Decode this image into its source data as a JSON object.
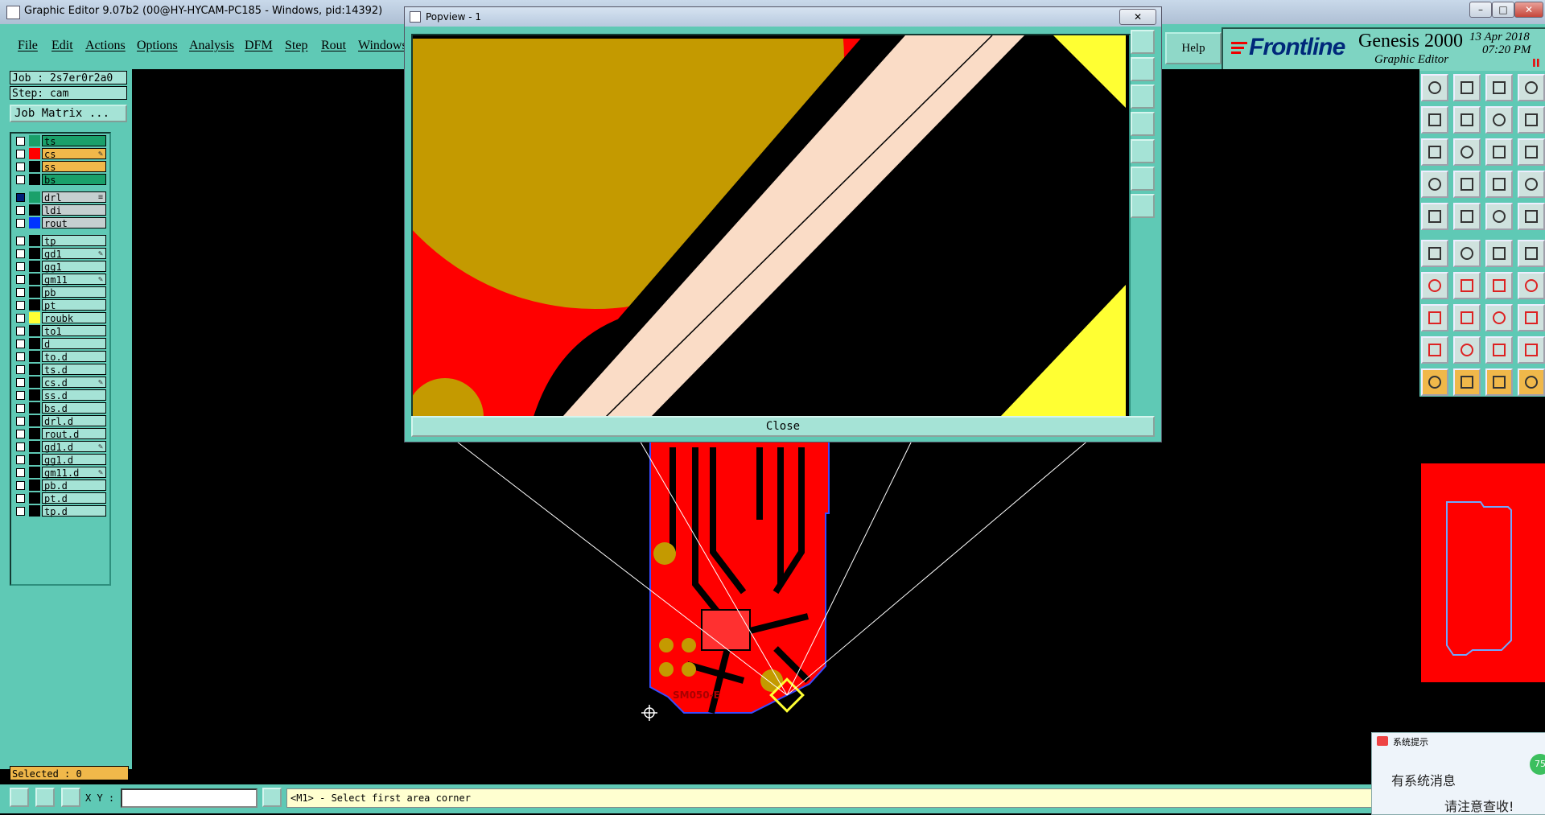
{
  "window": {
    "title": "Graphic Editor 9.07b2 (00@HY-HYCAM-PC185 - Windows, pid:14392)"
  },
  "menu": {
    "items": [
      "File",
      "Edit",
      "Actions",
      "Options",
      "Analysis",
      "DFM",
      "Step",
      "Rout",
      "Windows"
    ],
    "help": "Help"
  },
  "brand": {
    "frontline": "Frontline",
    "product": "Genesis 2000",
    "subtitle": "Graphic Editor",
    "date": "13 Apr 2018",
    "time": "07:20 PM",
    "pause": "II"
  },
  "job": {
    "job": "Job : 2s7er0r2a0",
    "step": "Step: cam",
    "matrix": "Job Matrix ..."
  },
  "layers": [
    {
      "name": "ts",
      "color": "#1aa06a",
      "bg": "#1aa06a"
    },
    {
      "name": "cs",
      "color": "#ff0000",
      "bg": "#f0b84a",
      "mark": "✎"
    },
    {
      "name": "ss",
      "color": "#000000",
      "bg": "#f0b84a"
    },
    {
      "name": "bs",
      "color": "#000000",
      "bg": "#1aa06a"
    },
    {
      "name": "drl",
      "color": "#1aa06a",
      "bg": "#c5cfd0",
      "mark": "≡",
      "check": "#00207a"
    },
    {
      "name": "ldi",
      "color": "#000000",
      "bg": "#c5cfd0"
    },
    {
      "name": "rout",
      "color": "#0033ff",
      "bg": "#c5cfd0"
    },
    {
      "name": "tp",
      "color": "#000000",
      "bg": "#a5e3d6"
    },
    {
      "name": "gd1",
      "color": "#000000",
      "bg": "#a5e3d6",
      "mark": "✎"
    },
    {
      "name": "gg1",
      "color": "#000000",
      "bg": "#a5e3d6"
    },
    {
      "name": "gm11",
      "color": "#000000",
      "bg": "#a5e3d6",
      "mark": "✎"
    },
    {
      "name": "pb",
      "color": "#000000",
      "bg": "#a5e3d6"
    },
    {
      "name": "pt",
      "color": "#000000",
      "bg": "#a5e3d6"
    },
    {
      "name": "roubk",
      "color": "#ffff33",
      "bg": "#a5e3d6"
    },
    {
      "name": "to1",
      "color": "#000000",
      "bg": "#a5e3d6"
    },
    {
      "name": "d",
      "color": "#000000",
      "bg": "#a5e3d6"
    },
    {
      "name": "to.d",
      "color": "#000000",
      "bg": "#a5e3d6"
    },
    {
      "name": "ts.d",
      "color": "#000000",
      "bg": "#a5e3d6"
    },
    {
      "name": "cs.d",
      "color": "#000000",
      "bg": "#a5e3d6",
      "mark": "✎"
    },
    {
      "name": "ss.d",
      "color": "#000000",
      "bg": "#a5e3d6"
    },
    {
      "name": "bs.d",
      "color": "#000000",
      "bg": "#a5e3d6"
    },
    {
      "name": "drl.d",
      "color": "#000000",
      "bg": "#a5e3d6"
    },
    {
      "name": "rout.d",
      "color": "#000000",
      "bg": "#a5e3d6"
    },
    {
      "name": "gd1.d",
      "color": "#000000",
      "bg": "#a5e3d6",
      "mark": "✎"
    },
    {
      "name": "gg1.d",
      "color": "#000000",
      "bg": "#a5e3d6"
    },
    {
      "name": "gm11.d",
      "color": "#000000",
      "bg": "#a5e3d6",
      "mark": "✎"
    },
    {
      "name": "pb.d",
      "color": "#000000",
      "bg": "#a5e3d6"
    },
    {
      "name": "pt.d",
      "color": "#000000",
      "bg": "#a5e3d6"
    },
    {
      "name": "tp.d",
      "color": "#000000",
      "bg": "#a5e3d6"
    }
  ],
  "status": {
    "selected": "Selected : 0",
    "xy_label": "X Y :",
    "xy_value": "",
    "message": "<M1> - Select first area corner"
  },
  "popview": {
    "title": "Popview - 1",
    "close": "Close",
    "close_glyph": "✕"
  },
  "notify": {
    "title": "系统提示",
    "line1": "有系统消息",
    "line2": "请注意查收!",
    "badge": "75"
  },
  "pcb_label": "SM050-E"
}
